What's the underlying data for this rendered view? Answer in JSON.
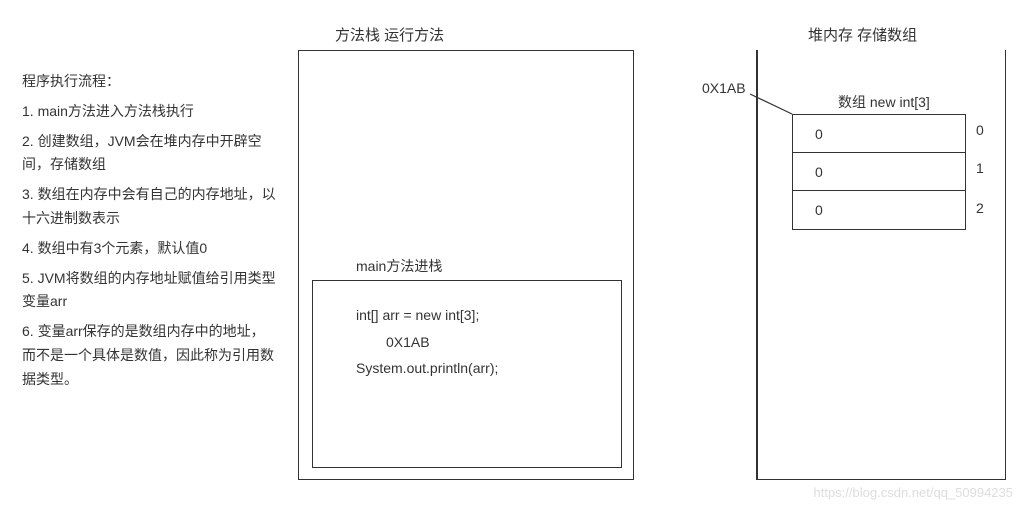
{
  "left": {
    "heading": "程序执行流程：",
    "items": [
      "1. main方法进入方法栈执行",
      "2. 创建数组，JVM会在堆内存中开辟空间，存储数组",
      "3. 数组在内存中会有自己的内存地址，以十六进制数表示",
      "4. 数组中有3个元素，默认值0",
      "5. JVM将数组的内存地址赋值给引用类型变量arr",
      "6. 变量arr保存的是数组内存中的地址，而不是一个具体是数值，因此称为引用数据类型。"
    ]
  },
  "stack": {
    "title": "方法栈   运行方法",
    "main_label": "main方法进栈",
    "code_line1": "int[] arr = new int[3];",
    "code_addr": "0X1AB",
    "code_line2": "System.out.println(arr);"
  },
  "heap": {
    "title": "堆内存   存储数组",
    "addr": "0X1AB",
    "array_label": "数组 new int[3]",
    "cells": [
      "0",
      "0",
      "0"
    ],
    "indices": [
      "0",
      "1",
      "2"
    ]
  },
  "watermark": "https://blog.csdn.net/qq_50994235"
}
